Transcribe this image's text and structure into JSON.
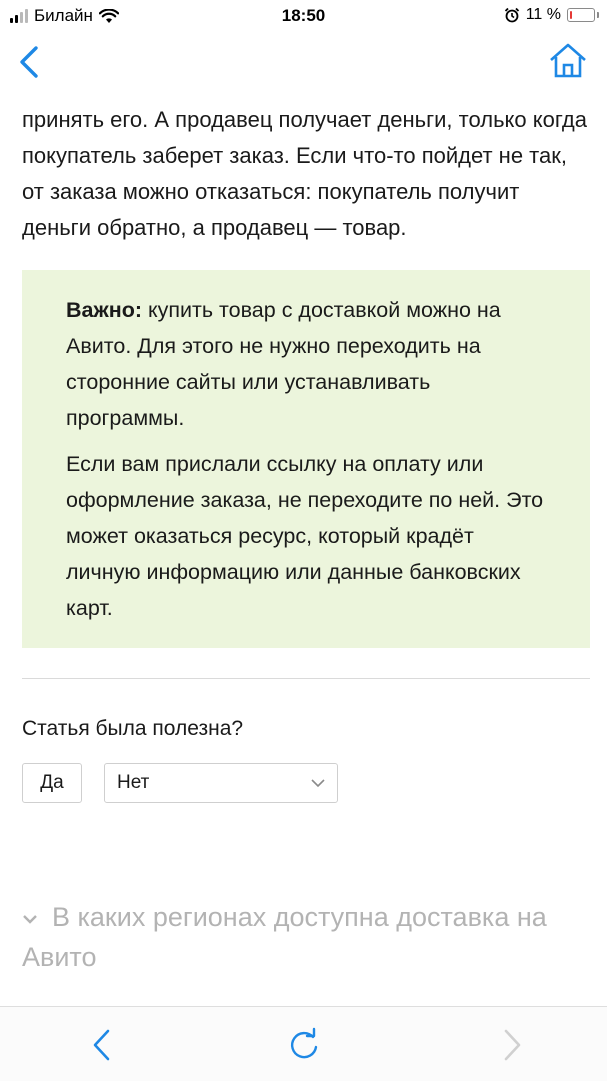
{
  "status_bar": {
    "carrier": "Билайн",
    "time": "18:50",
    "battery_percent": "11 %",
    "battery_level": 0.11
  },
  "nav": {
    "back_icon": "chevron-left-icon",
    "home_icon": "home-icon",
    "accent_color": "#1e88e5"
  },
  "article": {
    "paragraph": "принять его. А продавец получает деньги, только когда покупатель заберет заказ. Если что-то пойдет не так, от заказа можно отказаться: покупатель получит деньги обратно, а продавец — товар.",
    "callout_bg": "#ecf5dc",
    "callout_strong": "Важно:",
    "callout_text_1": " купить товар с доставкой можно на Авито. Для этого не нужно переходить на сторонние сайты или устанавливать программы.",
    "callout_text_2": "Если вам прислали ссылку на оплату или оформление заказа, не переходите по ней. Это может оказаться ресурс, который крадёт личную информацию или данные банковских карт."
  },
  "feedback": {
    "question": "Статья была полезна?",
    "yes_label": "Да",
    "no_label": "Нет"
  },
  "related": {
    "title": "В каких регионах доступна доставка на Авито"
  },
  "toolbar": {
    "back_icon": "chevron-left-icon",
    "reload_icon": "reload-icon",
    "forward_icon": "chevron-right-icon"
  }
}
